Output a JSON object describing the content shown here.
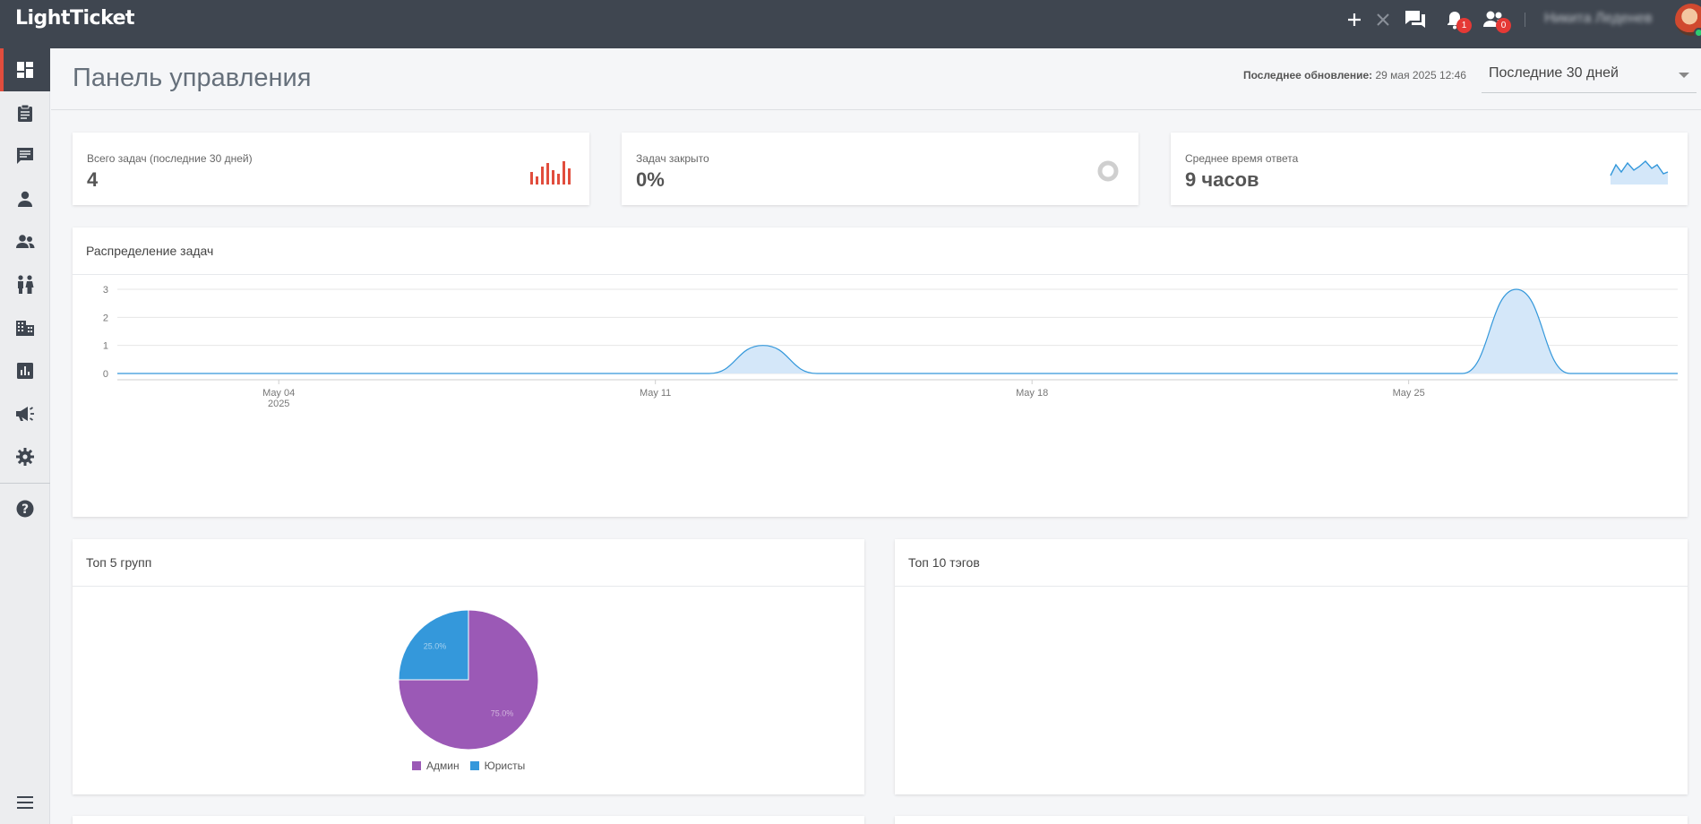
{
  "app": {
    "logo": "LightTicket"
  },
  "topbar": {
    "notifications_count": "1",
    "users_count": "0",
    "username": "Никита Леденев",
    "icons": [
      "plus-icon",
      "close-icon",
      "chat-icon",
      "bell-icon",
      "users-icon"
    ]
  },
  "sidebar": {
    "items": [
      {
        "name": "dashboard",
        "icon": "dashboard-icon",
        "active": true
      },
      {
        "name": "tickets",
        "icon": "clipboard-icon"
      },
      {
        "name": "messages",
        "icon": "message-icon"
      },
      {
        "name": "user",
        "icon": "person-icon"
      },
      {
        "name": "groups",
        "icon": "group-icon"
      },
      {
        "name": "teams",
        "icon": "people-icon"
      },
      {
        "name": "organizations",
        "icon": "building-icon"
      },
      {
        "name": "reports",
        "icon": "chart-icon"
      },
      {
        "name": "announcements",
        "icon": "megaphone-icon"
      },
      {
        "name": "settings",
        "icon": "gear-icon"
      },
      {
        "name": "help",
        "icon": "help-icon"
      }
    ],
    "menu_icon": "menu-icon"
  },
  "header": {
    "title": "Панель управления",
    "last_update_label": "Последнее обновление:",
    "last_update_value": "29 мая 2025 12:46",
    "period": "Последние 30 дней"
  },
  "stats": [
    {
      "label": "Всего задач (последние 30 дней)",
      "value": "4"
    },
    {
      "label": "Задач закрыто",
      "value": "0%"
    },
    {
      "label": "Среднее время ответа",
      "value": "9 часов"
    }
  ],
  "colors": {
    "accent": "#e14d3d",
    "line": "#3498db",
    "area": "#d4e7f9",
    "admin": "#9b59b6",
    "lawyers": "#3498db"
  },
  "distribution": {
    "title": "Распределение задач"
  },
  "top_groups": {
    "title": "Топ 5 групп"
  },
  "top_tags": {
    "title": "Топ 10 тэгов"
  },
  "chart_data": [
    {
      "type": "area",
      "title": "Распределение задач",
      "x_ticks": [
        "May 04",
        "May 11",
        "May 18",
        "May 25"
      ],
      "x_tick_sub": [
        "2025",
        "",
        "",
        ""
      ],
      "y_ticks": [
        0,
        1,
        2,
        3
      ],
      "ylim": [
        0,
        3
      ],
      "x": [
        "2025-05-01",
        "2025-05-02",
        "2025-05-03",
        "2025-05-04",
        "2025-05-05",
        "2025-05-06",
        "2025-05-07",
        "2025-05-08",
        "2025-05-09",
        "2025-05-10",
        "2025-05-11",
        "2025-05-12",
        "2025-05-13",
        "2025-05-14",
        "2025-05-15",
        "2025-05-16",
        "2025-05-17",
        "2025-05-18",
        "2025-05-19",
        "2025-05-20",
        "2025-05-21",
        "2025-05-22",
        "2025-05-23",
        "2025-05-24",
        "2025-05-25",
        "2025-05-26",
        "2025-05-27",
        "2025-05-28",
        "2025-05-29",
        "2025-05-30"
      ],
      "y": [
        0,
        0,
        0,
        0,
        0,
        0,
        0,
        0,
        0,
        0,
        0,
        0,
        1,
        0,
        0,
        0,
        0,
        0,
        0,
        0,
        0,
        0,
        0,
        0,
        0,
        0,
        3,
        0,
        0,
        0
      ],
      "grid": true
    },
    {
      "type": "pie",
      "title": "Топ 5 групп",
      "slices": [
        {
          "label": "Админ",
          "value": 75.0,
          "text": "75.0%",
          "color": "#9b59b6"
        },
        {
          "label": "Юристы",
          "value": 25.0,
          "text": "25.0%",
          "color": "#3498db"
        }
      ],
      "legend": "bottom"
    }
  ]
}
